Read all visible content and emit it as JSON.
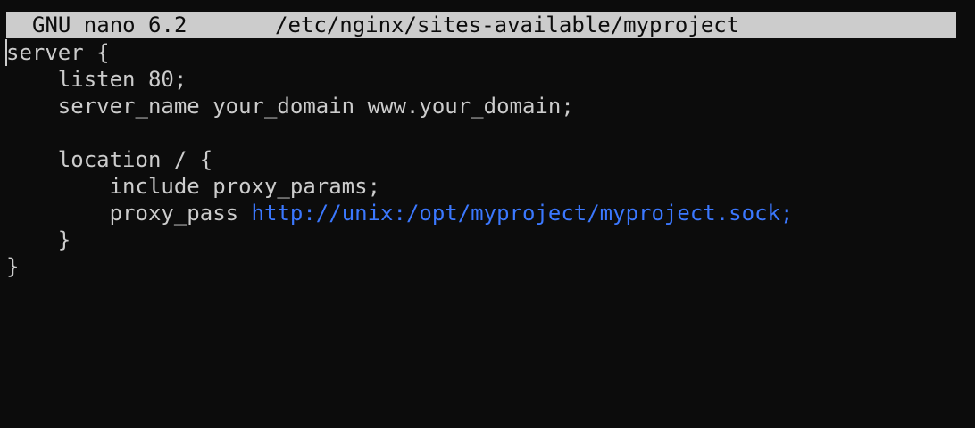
{
  "nano": {
    "app_label": "GNU nano 6.2",
    "file_path": "/etc/nginx/sites-available/myproject"
  },
  "colors": {
    "background": "#0c0c0c",
    "text": "#cccccc",
    "titlebar_bg": "#cccccc",
    "url": "#3b78ff"
  },
  "editor": {
    "lines": [
      {
        "text": "server {",
        "indent": 0
      },
      {
        "text": "listen 80;",
        "indent": 4
      },
      {
        "text": "server_name your_domain www.your_domain;",
        "indent": 4
      },
      {
        "text": "",
        "indent": 0
      },
      {
        "text": "location / {",
        "indent": 4
      },
      {
        "text": "include proxy_params;",
        "indent": 8
      },
      {
        "text": "proxy_pass",
        "indent": 8,
        "url": "http://unix:/opt/myproject/myproject.sock;"
      },
      {
        "text": "}",
        "indent": 4
      },
      {
        "text": "}",
        "indent": 0
      }
    ]
  }
}
